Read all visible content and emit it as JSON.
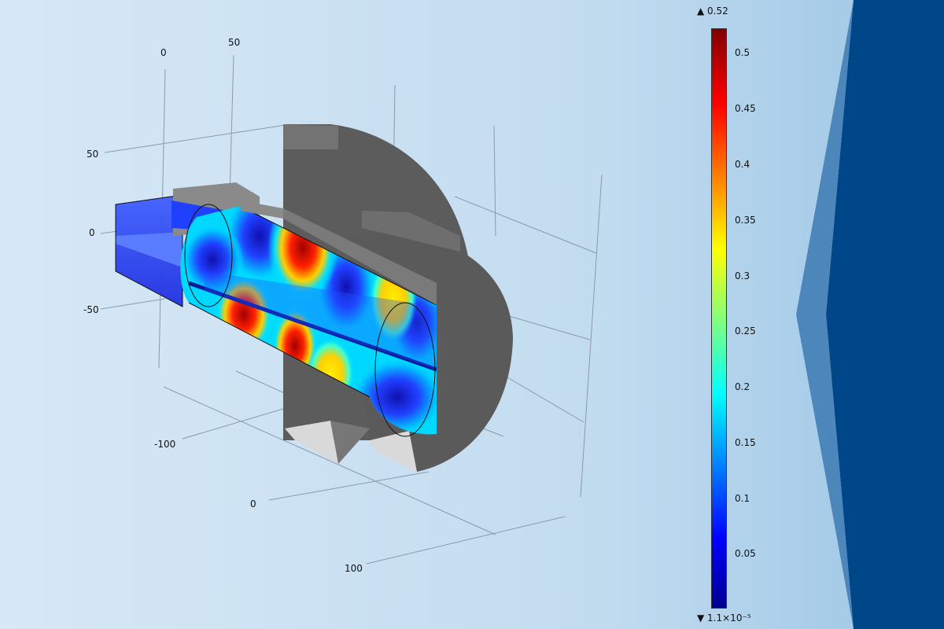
{
  "axes": {
    "x_ticks": [
      "0",
      "50"
    ],
    "z_ticks": [
      "50",
      "0",
      "-50"
    ],
    "y_ticks": [
      "-100",
      "0",
      "100"
    ]
  },
  "colorbar": {
    "max_label": "▲ 0.52",
    "min_label": "▼ 1.1×10⁻⁵",
    "ticks": [
      "0.5",
      "0.45",
      "0.4",
      "0.35",
      "0.3",
      "0.25",
      "0.2",
      "0.15",
      "0.1",
      "0.05"
    ],
    "range": [
      1.1e-05,
      0.52
    ],
    "colormap": "rainbow",
    "colors": [
      "#00008f",
      "#0000ff",
      "#00ffff",
      "#ffff00",
      "#ff0000",
      "#800000"
    ]
  },
  "colors": {
    "background_left": "#d8e8f5",
    "background_right": "#a8cde9",
    "side_panel": "#00478a",
    "side_accent": "#4d86bb",
    "geometry_gray": "#5c5c5c"
  }
}
